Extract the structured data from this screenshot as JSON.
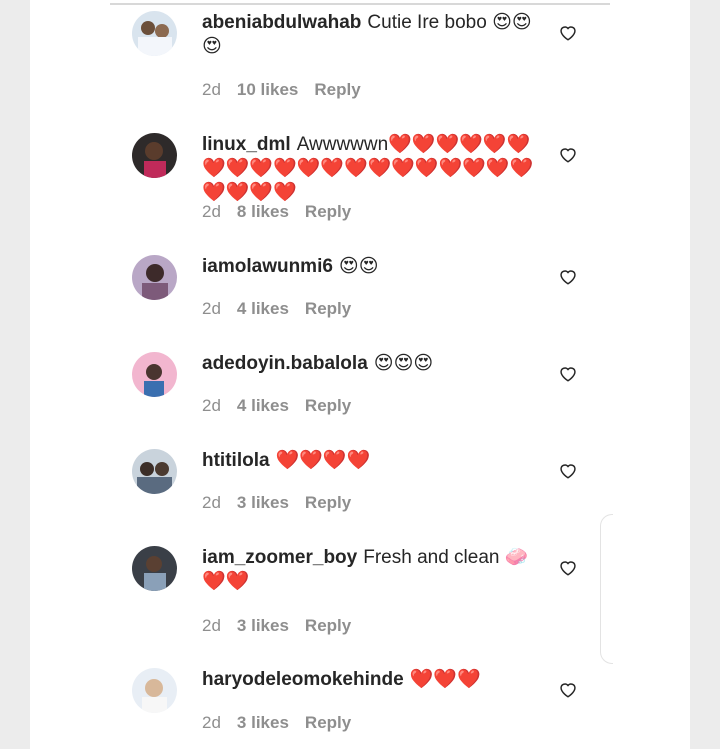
{
  "comments": [
    {
      "username": "abeniabdulwahab",
      "text": "Cutie Ire bobo",
      "emoji": "😍😍😍",
      "time": "2d",
      "likes": "10 likes",
      "reply": "Reply"
    },
    {
      "username": "linux_dml",
      "text": "Awwwwwn",
      "emoji": "❤️❤️❤️❤️❤️❤️❤️❤️❤️❤️❤️❤️❤️❤️❤️❤️❤️❤️❤️❤️❤️❤️❤️❤️",
      "time": "2d",
      "likes": "8 likes",
      "reply": "Reply"
    },
    {
      "username": "iamolawunmi6",
      "text": "",
      "emoji": "😍😍",
      "time": "2d",
      "likes": "4 likes",
      "reply": "Reply"
    },
    {
      "username": "adedoyin.babalola",
      "text": "",
      "emoji": "😍😍😍",
      "time": "2d",
      "likes": "4 likes",
      "reply": "Reply"
    },
    {
      "username": "htitilola",
      "text": "",
      "emoji": "❤️❤️❤️❤️",
      "time": "2d",
      "likes": "3 likes",
      "reply": "Reply"
    },
    {
      "username": "iam_zoomer_boy",
      "text": "Fresh and clean",
      "emoji": "🧼❤️❤️",
      "time": "2d",
      "likes": "3 likes",
      "reply": "Reply"
    },
    {
      "username": "haryodeleomokehinde",
      "text": "",
      "emoji": "❤️❤️❤️",
      "time": "2d",
      "likes": "3 likes",
      "reply": "Reply"
    }
  ],
  "colors": {
    "text": "#262626",
    "meta": "#8e8e8e",
    "heart": "#d0021b"
  }
}
